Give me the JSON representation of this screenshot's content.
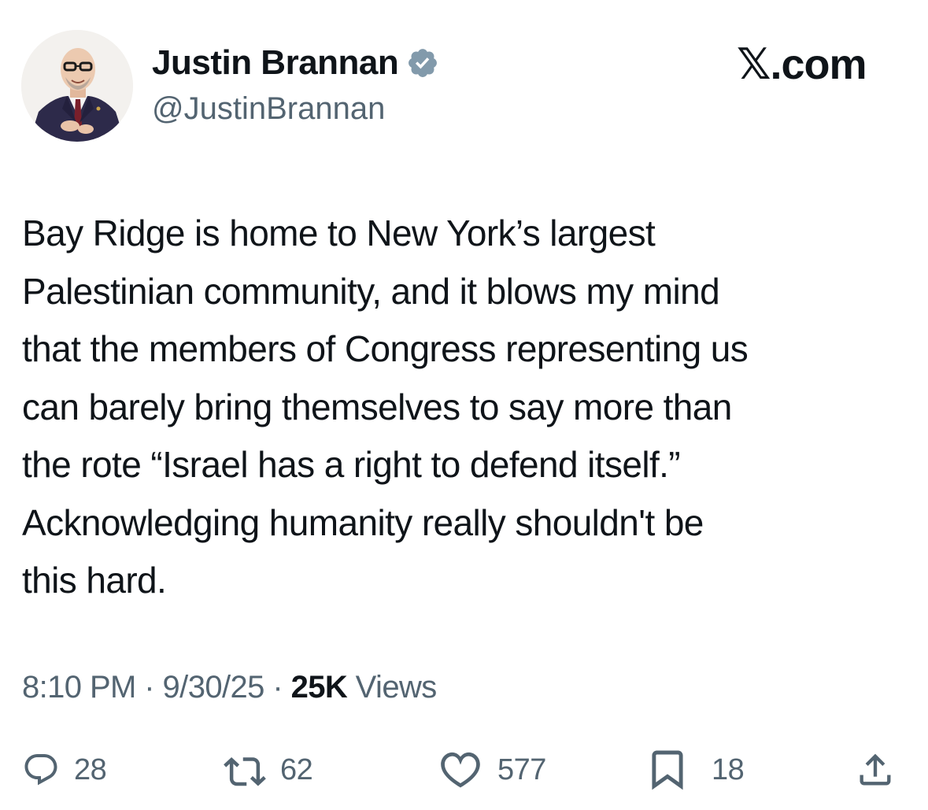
{
  "author": {
    "display_name": "Justin Brannan",
    "handle": "@JustinBrannan",
    "verified": true,
    "avatar_icon": "profile-photo"
  },
  "brand": "𝕏.com",
  "tweet": {
    "lines": [
      "Bay Ridge is home to New York’s largest",
      "Palestinian community, and it blows my mind",
      "that the members of Congress representing us",
      "can barely bring themselves to say more than",
      "the rote “Israel has a right to defend itself.”",
      "Acknowledging humanity really shouldn't be",
      "this hard."
    ]
  },
  "meta": {
    "time": "8:10 PM",
    "separator": "·",
    "date": "9/30/25",
    "views_count": "25K",
    "views_label": "Views"
  },
  "actions": {
    "replies": {
      "icon": "reply-icon",
      "count": "28"
    },
    "reposts": {
      "icon": "repost-icon",
      "count": "62"
    },
    "likes": {
      "icon": "like-icon",
      "count": "577"
    },
    "bookmarks": {
      "icon": "bookmark-icon",
      "count": "18"
    },
    "share": {
      "icon": "share-icon"
    }
  },
  "colors": {
    "text": "#0f1419",
    "secondary": "#536471",
    "verified_badge": "#829aab"
  }
}
